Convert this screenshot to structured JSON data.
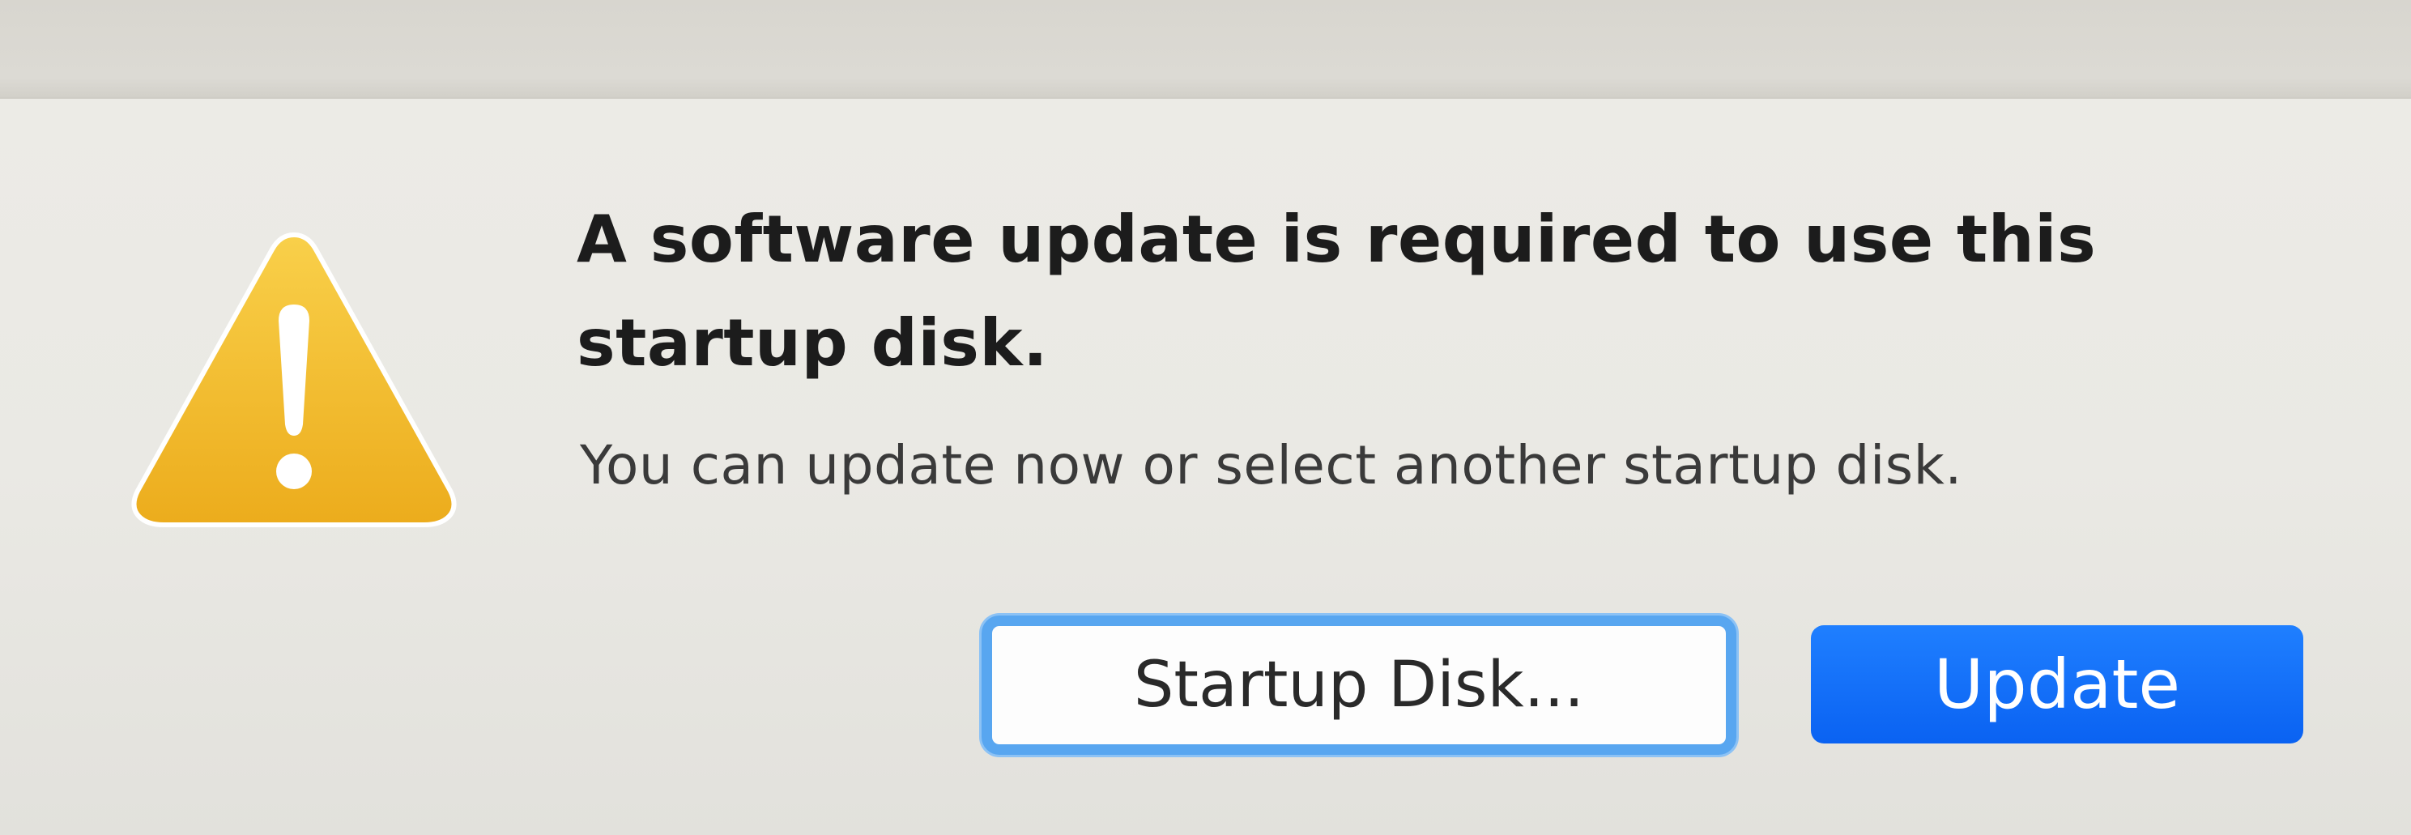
{
  "dialog": {
    "icon": "warning-triangle-icon",
    "title_line1": "A software update is required to use this",
    "title_line2": "startup disk.",
    "message": "You can update now or select another startup disk.",
    "buttons": {
      "secondary_label": "Startup Disk...",
      "primary_label": "Update"
    }
  },
  "colors": {
    "accent": "#0a62f2",
    "focus_ring": "#58a6f0",
    "warning": "#f0b62a"
  }
}
